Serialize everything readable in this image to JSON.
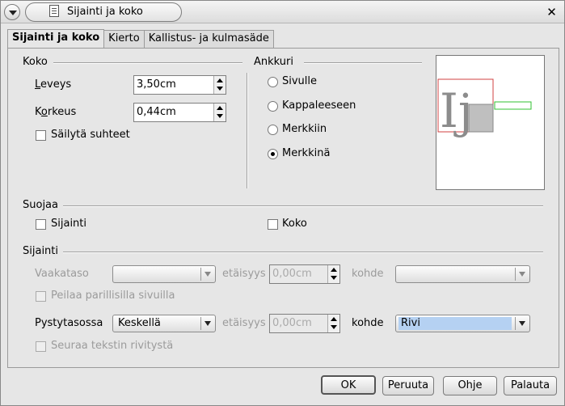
{
  "window": {
    "title": "Sijainti ja koko"
  },
  "tabs": [
    "Sijainti ja koko",
    "Kierto",
    "Kallistus- ja kulmasäde"
  ],
  "koko": {
    "heading": "Koko",
    "width_label": "Leveys",
    "width_value": "3,50cm",
    "height_label": "Korkeus",
    "height_value": "0,44cm",
    "keep_ratio_label": "Säilytä suhteet"
  },
  "ankkuri": {
    "heading": "Ankkuri",
    "options": [
      "Sivulle",
      "Kappaleeseen",
      "Merkkiin",
      "Merkkinä"
    ],
    "selected_index": 3
  },
  "suojaa": {
    "heading": "Suojaa",
    "position_label": "Sijainti",
    "size_label": "Koko"
  },
  "sijainti": {
    "heading": "Sijainti",
    "horizontal_label": "Vaakataso",
    "distance_label": "etäisyys",
    "distance_value": "0,00cm",
    "target_label": "kohde",
    "mirror_label": "Peilaa parillisilla sivuilla",
    "vertical_label": "Pystytasossa",
    "vertical_value": "Keskellä",
    "vertical_target_value": "Rivi",
    "follow_text_label": "Seuraa tekstin rivitystä"
  },
  "preview": {
    "glyph": "Ij"
  },
  "buttons": {
    "ok": "OK",
    "cancel": "Peruuta",
    "help": "Ohje",
    "reset": "Palauta"
  },
  "colors": {
    "preview_frame": "#d24040",
    "preview_box": "#bfbfbf",
    "preview_green": "#30c030",
    "highlight": "#b5d1f2"
  }
}
